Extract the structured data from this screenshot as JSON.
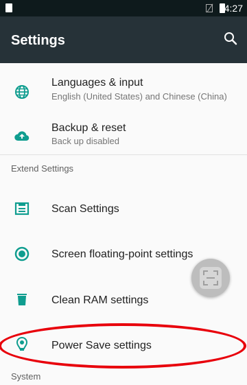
{
  "status_bar": {
    "time": "4:27"
  },
  "app_bar": {
    "title": "Settings",
    "search_icon": "search-icon"
  },
  "items": [
    {
      "label": "Languages & input",
      "sub": "English (United States) and Chinese (China)",
      "icon": "globe-icon"
    },
    {
      "label": "Backup & reset",
      "sub": "Back up disabled",
      "icon": "cloud-upload-icon"
    }
  ],
  "extend": {
    "header": "Extend Settings",
    "items": [
      {
        "label": "Scan Settings",
        "icon": "scanner-icon"
      },
      {
        "label": "Screen floating-point settings",
        "icon": "floating-point-icon"
      },
      {
        "label": "Clean RAM settings",
        "icon": "trash-icon"
      },
      {
        "label": "Power Save settings",
        "icon": "power-save-icon"
      }
    ]
  },
  "system": {
    "header": "System"
  },
  "colors": {
    "accent": "#0f9d8f",
    "appbar": "#263238",
    "annotation": "#e8000b"
  }
}
